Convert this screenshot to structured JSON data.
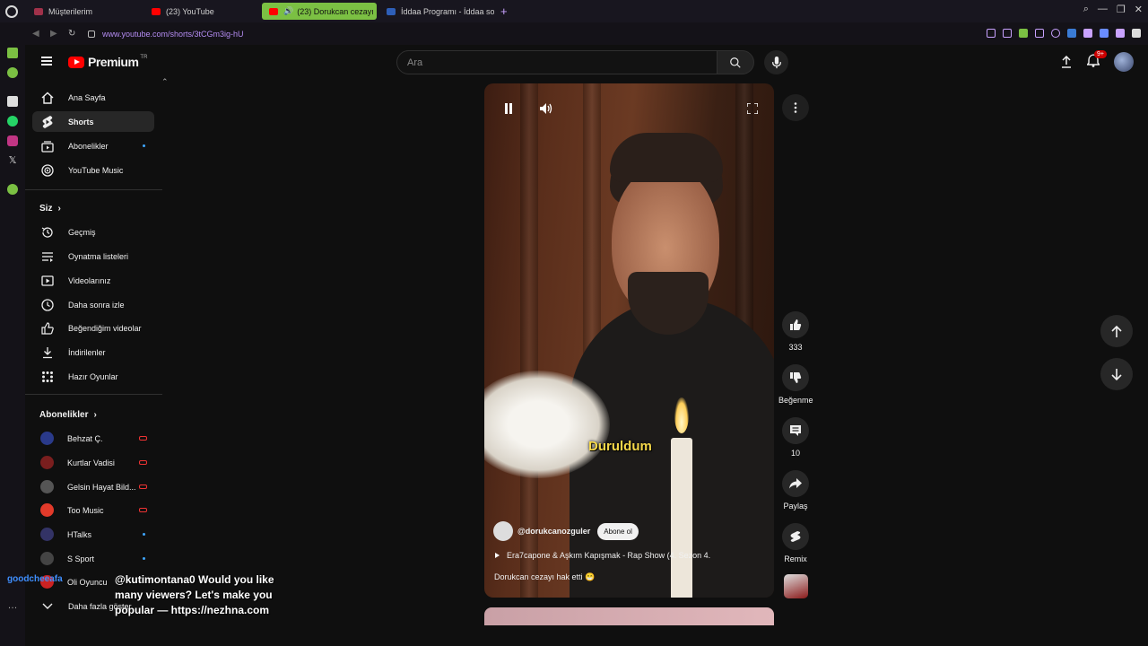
{
  "browser": {
    "tabs": [
      {
        "label": "Müşterilerim",
        "active": false
      },
      {
        "label": "(23) YouTube",
        "active": false
      },
      {
        "label": "(23) Dorukcan cezayı",
        "active": true
      },
      {
        "label": "İddaa Programı - İddaa so",
        "active": false
      }
    ],
    "url": "www.youtube.com/shorts/3tCGm3ig-hU",
    "accent": "#7bc043"
  },
  "header": {
    "brand": "Premium",
    "brand_sup": "TR",
    "search_placeholder": "Ara",
    "notifications_badge": "9+"
  },
  "sidebar": {
    "main": [
      {
        "label": "Ana Sayfa",
        "icon": "home-icon"
      },
      {
        "label": "Shorts",
        "icon": "shorts-icon",
        "active": true
      },
      {
        "label": "Abonelikler",
        "icon": "subscriptions-icon",
        "dot": true
      },
      {
        "label": "YouTube Music",
        "icon": "music-icon"
      }
    ],
    "you_title": "Siz",
    "you": [
      {
        "label": "Geçmiş",
        "icon": "history-icon"
      },
      {
        "label": "Oynatma listeleri",
        "icon": "playlist-icon"
      },
      {
        "label": "Videolarınız",
        "icon": "your-videos-icon"
      },
      {
        "label": "Daha sonra izle",
        "icon": "clock-icon"
      },
      {
        "label": "Beğendiğim videolar",
        "icon": "like-icon"
      },
      {
        "label": "İndirilenler",
        "icon": "download-icon"
      },
      {
        "label": "Hazır Oyunlar",
        "icon": "games-icon"
      }
    ],
    "subs_title": "Abonelikler",
    "subs": [
      {
        "label": "Behzat Ç.",
        "indicator": "live",
        "color": "#2a3a8a"
      },
      {
        "label": "Kurtlar Vadisi",
        "indicator": "live",
        "color": "#7a1e1e"
      },
      {
        "label": "Gelsin Hayat Bild...",
        "indicator": "live",
        "color": "#555555"
      },
      {
        "label": "Too Music",
        "indicator": "live",
        "color": "#e23a2a"
      },
      {
        "label": "HTalks",
        "indicator": "dot",
        "color": "#333366"
      },
      {
        "label": "S Sport",
        "indicator": "dot",
        "color": "#444444"
      },
      {
        "label": "Oli Oyuncu",
        "indicator": "none",
        "color": "#cc2222"
      }
    ],
    "show_more": "Daha fazla göster"
  },
  "short": {
    "caption": "Duruldum",
    "channel": "@dorukcanozguler",
    "subscribe": "Abone ol",
    "music": "Era7capone & Aşkım Kapışmak - Rap Show (4. Sezon 4.",
    "description": "Dorukcan cezayı hak etti 😁"
  },
  "actions": {
    "likes": "333",
    "dislike_label": "Beğenme",
    "comments": "10",
    "share_label": "Paylaş",
    "remix_label": "Remix"
  },
  "overlay": {
    "user": "goodcheeafa",
    "message": "@kutimontana0 Would you like many viewers? Let's make you popular — https://nezhna.com"
  }
}
